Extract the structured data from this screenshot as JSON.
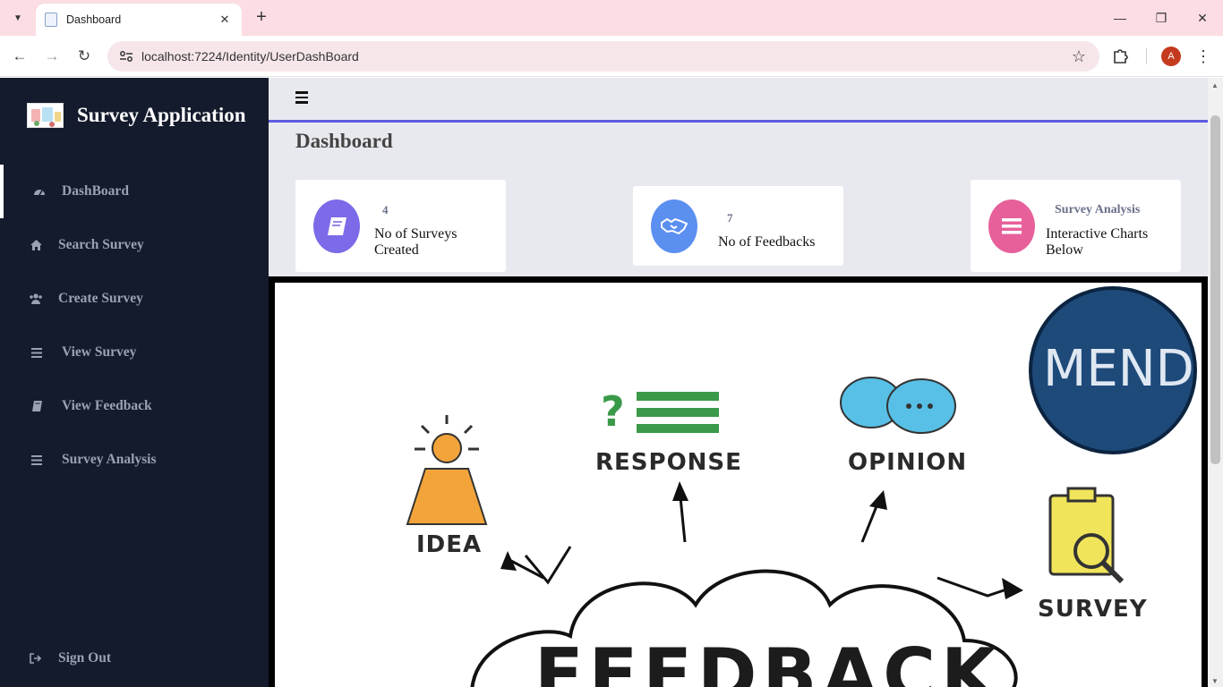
{
  "browser": {
    "tab_title": "Dashboard",
    "url": "localhost:7224/Identity/UserDashBoard",
    "profile_initial": "A"
  },
  "sidebar": {
    "brand": "Survey Application",
    "items": [
      {
        "label": "DashBoard",
        "icon": "dashboard-gauge-icon"
      },
      {
        "label": "Search Survey",
        "icon": "home-icon"
      },
      {
        "label": "Create Survey",
        "icon": "users-icon"
      },
      {
        "label": "View Survey",
        "icon": "list-icon"
      },
      {
        "label": "View Feedback",
        "icon": "book-icon"
      },
      {
        "label": "Survey Analysis",
        "icon": "list-icon"
      }
    ],
    "signout": {
      "label": "Sign Out",
      "icon": "sign-out-icon"
    }
  },
  "main": {
    "title": "Dashboard",
    "cards": [
      {
        "value": "4",
        "label": "No of Surveys Created",
        "icon": "book-icon",
        "color": "#7b6be8"
      },
      {
        "value": "7",
        "label": "No of Feedbacks",
        "icon": "handshake-icon",
        "color": "#5b8ff0"
      },
      {
        "value": "Survey Analysis",
        "label": "Interactive Charts Below",
        "icon": "bars-icon",
        "color": "#e7609a"
      }
    ],
    "illustration": {
      "labels": {
        "idea": "IDEA",
        "response": "RESPONSE",
        "opinion": "OPINION",
        "survey": "SURVEY",
        "center": "FEEDBACK",
        "badge": "MEND"
      }
    }
  },
  "colors": {
    "sidebar_bg": "#141b2d",
    "main_bg": "#e8e9ee",
    "topbar_accent": "#5c5ce0",
    "tabbar_bg": "#fbdde3"
  }
}
